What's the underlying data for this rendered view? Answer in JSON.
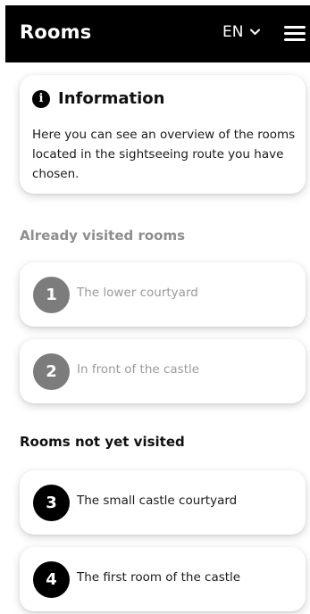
{
  "header": {
    "title": "Rooms",
    "language": "EN",
    "language_icon": "chevron-down-icon",
    "menu_icon": "hamburger-menu-icon",
    "background_color": "#000000"
  },
  "info": {
    "icon": "info-icon",
    "icon_glyph": "i",
    "title": "Information",
    "text": "Here you can see an overview of the rooms located in the sightseeing route you have chosen."
  },
  "visited": {
    "title": "Already visited rooms",
    "color": "#7c7c7c",
    "rooms": [
      {
        "number": "1",
        "name": "The lower courtyard"
      },
      {
        "number": "2",
        "name": "In front of the castle"
      }
    ]
  },
  "not_visited": {
    "title": "Rooms not yet visited",
    "color": "#000000",
    "rooms": [
      {
        "number": "3",
        "name": "The small castle courtyard"
      },
      {
        "number": "4",
        "name": "The first room of the castle"
      }
    ]
  }
}
